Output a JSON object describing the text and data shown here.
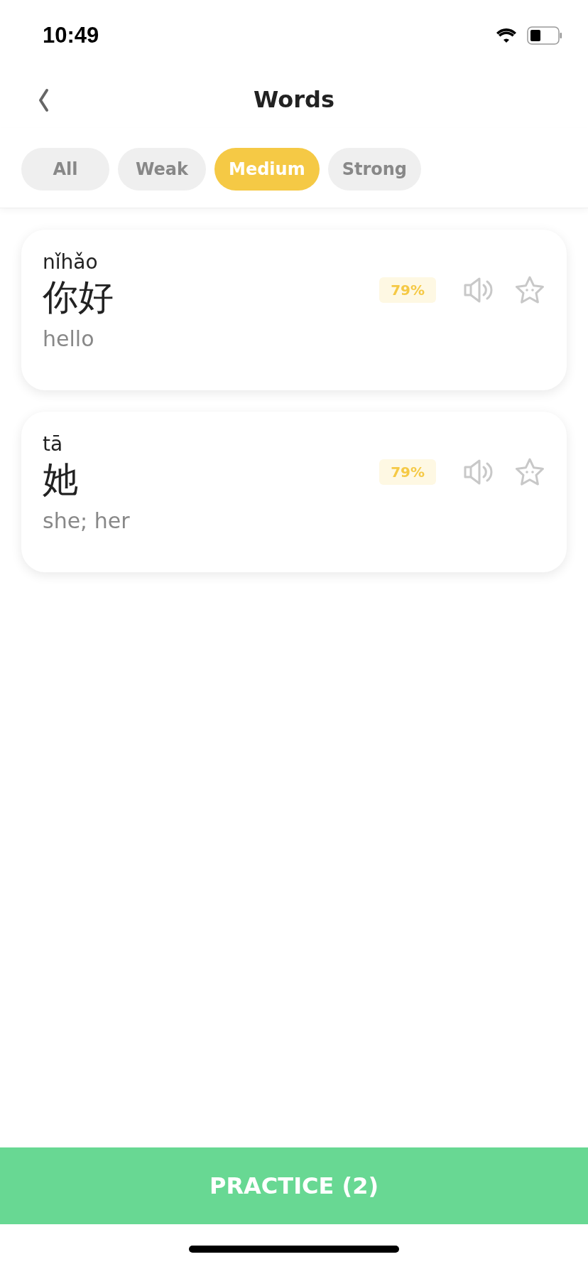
{
  "status_bar": {
    "time": "10:49"
  },
  "header": {
    "title": "Words"
  },
  "tabs": [
    {
      "label": "All",
      "selected": false
    },
    {
      "label": "Weak",
      "selected": false
    },
    {
      "label": "Medium",
      "selected": true
    },
    {
      "label": "Strong",
      "selected": false
    }
  ],
  "words": [
    {
      "pinyin": "nǐhǎo",
      "hanzi": "你好",
      "meaning": "hello",
      "score": "79%"
    },
    {
      "pinyin": "tā",
      "hanzi": "她",
      "meaning": "she; her",
      "score": "79%"
    }
  ],
  "practice_button": {
    "label": "PRACTICE (2)"
  }
}
